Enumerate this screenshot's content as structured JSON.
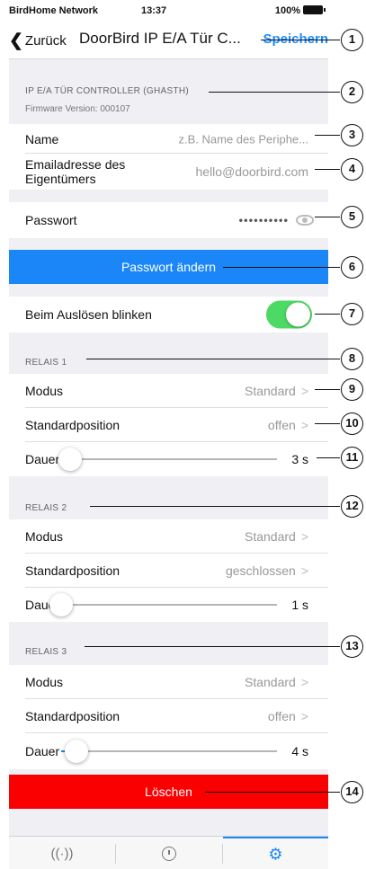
{
  "status_bar": {
    "carrier": "BirdHome Network",
    "time": "13:37",
    "battery": "100%"
  },
  "nav": {
    "back_label": "Zurück",
    "title": "DoorBird IP E/A Tür C...",
    "save_label": "Speichern"
  },
  "device_section": {
    "header": "IP E/A TÜR CONTROLLER (GHASTH)",
    "firmware": "Firmware Version: 000107"
  },
  "name_row": {
    "label": "Name",
    "placeholder": "z.B. Name des Periphe..."
  },
  "email_row": {
    "label": "Emailadresse des Eigentümers",
    "value": "hello@doorbird.com"
  },
  "password_row": {
    "label": "Passwort",
    "value": "••••••••••"
  },
  "change_password_button": "Passwort ändern",
  "blink_row": {
    "label": "Beim Auslösen blinken",
    "enabled": true
  },
  "relays": [
    {
      "header": "RELAIS 1",
      "mode_label": "Modus",
      "mode_value": "Standard",
      "position_label": "Standardposition",
      "position_value": "offen",
      "duration_label": "Dauer",
      "duration_value": "3 s",
      "duration_fraction": 0.04
    },
    {
      "header": "RELAIS 2",
      "mode_label": "Modus",
      "mode_value": "Standard",
      "position_label": "Standardposition",
      "position_value": "geschlossen",
      "duration_label": "Dauer",
      "duration_value": "1 s",
      "duration_fraction": 0.0
    },
    {
      "header": "RELAIS 3",
      "mode_label": "Modus",
      "mode_value": "Standard",
      "position_label": "Standardposition",
      "position_value": "offen",
      "duration_label": "Dauer",
      "duration_value": "4 s",
      "duration_fraction": 0.07
    }
  ],
  "delete_button": "Löschen",
  "tabs": [
    {
      "icon": "signal-icon",
      "glyph": "((·))"
    },
    {
      "icon": "clock-icon",
      "glyph": ""
    },
    {
      "icon": "gear-icon",
      "glyph": "⚙",
      "selected": true
    }
  ],
  "callouts": [
    "1",
    "2",
    "3",
    "4",
    "5",
    "6",
    "7",
    "8",
    "9",
    "10",
    "11",
    "12",
    "13",
    "14"
  ],
  "colors": {
    "accent": "#1a86f8",
    "toggle_on": "#4cd964",
    "danger": "#fb0000",
    "background": "#efeff4"
  }
}
